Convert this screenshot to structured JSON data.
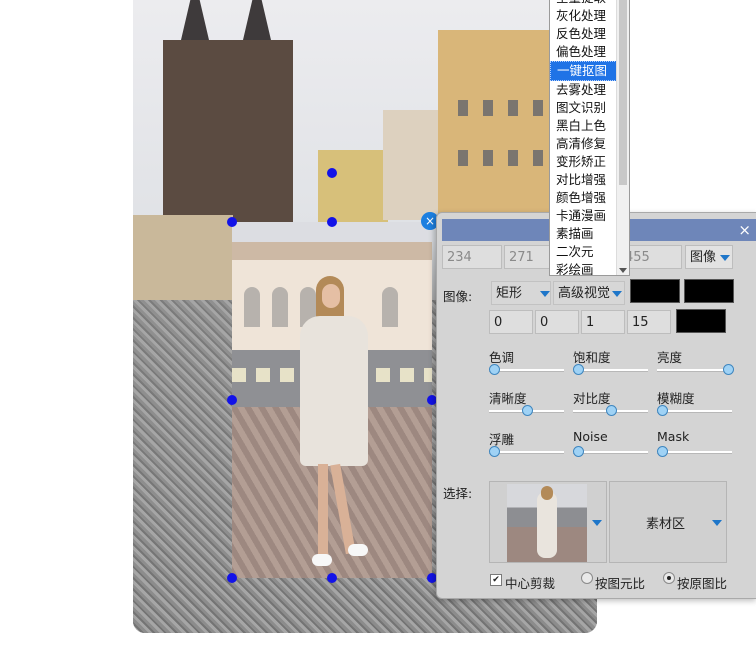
{
  "dropdown": {
    "items": [
      "全量提取",
      "灰化处理",
      "反色处理",
      "偏色处理",
      "一键抠图",
      "去雾处理",
      "图文识别",
      "黑白上色",
      "高清修复",
      "变形矫正",
      "对比增强",
      "颜色增强",
      "卡通漫画",
      "素描画",
      "二次元",
      "彩绘画"
    ],
    "selected_index": 4
  },
  "panel": {
    "close": "×",
    "row1": {
      "v1": "234",
      "v2": "271",
      "v3": "455",
      "mode": "图像"
    },
    "row2": {
      "label": "图像:",
      "shape": "矩形",
      "view": "高级视觉"
    },
    "row3": {
      "v1": "0",
      "v2": "0",
      "v3": "1",
      "v4": "15"
    },
    "sliders": [
      {
        "label": "色调",
        "value": 0
      },
      {
        "label": "饱和度",
        "value": 0
      },
      {
        "label": "亮度",
        "value": 1
      },
      {
        "label": "清晰度",
        "value": 0.5
      },
      {
        "label": "对比度",
        "value": 0.5
      },
      {
        "label": "模糊度",
        "value": 0
      },
      {
        "label": "浮雕",
        "value": 0
      },
      {
        "label": "Noise",
        "value": 0
      },
      {
        "label": "Mask",
        "value": 0
      }
    ],
    "select_label": "选择:",
    "material": "素材区",
    "center_crop": "中心剪裁",
    "center_crop_checked": true,
    "ratio_options": [
      "按图元比",
      "按原图比"
    ],
    "ratio_selected": 1
  },
  "canvas": {
    "close_glyph": "×"
  }
}
